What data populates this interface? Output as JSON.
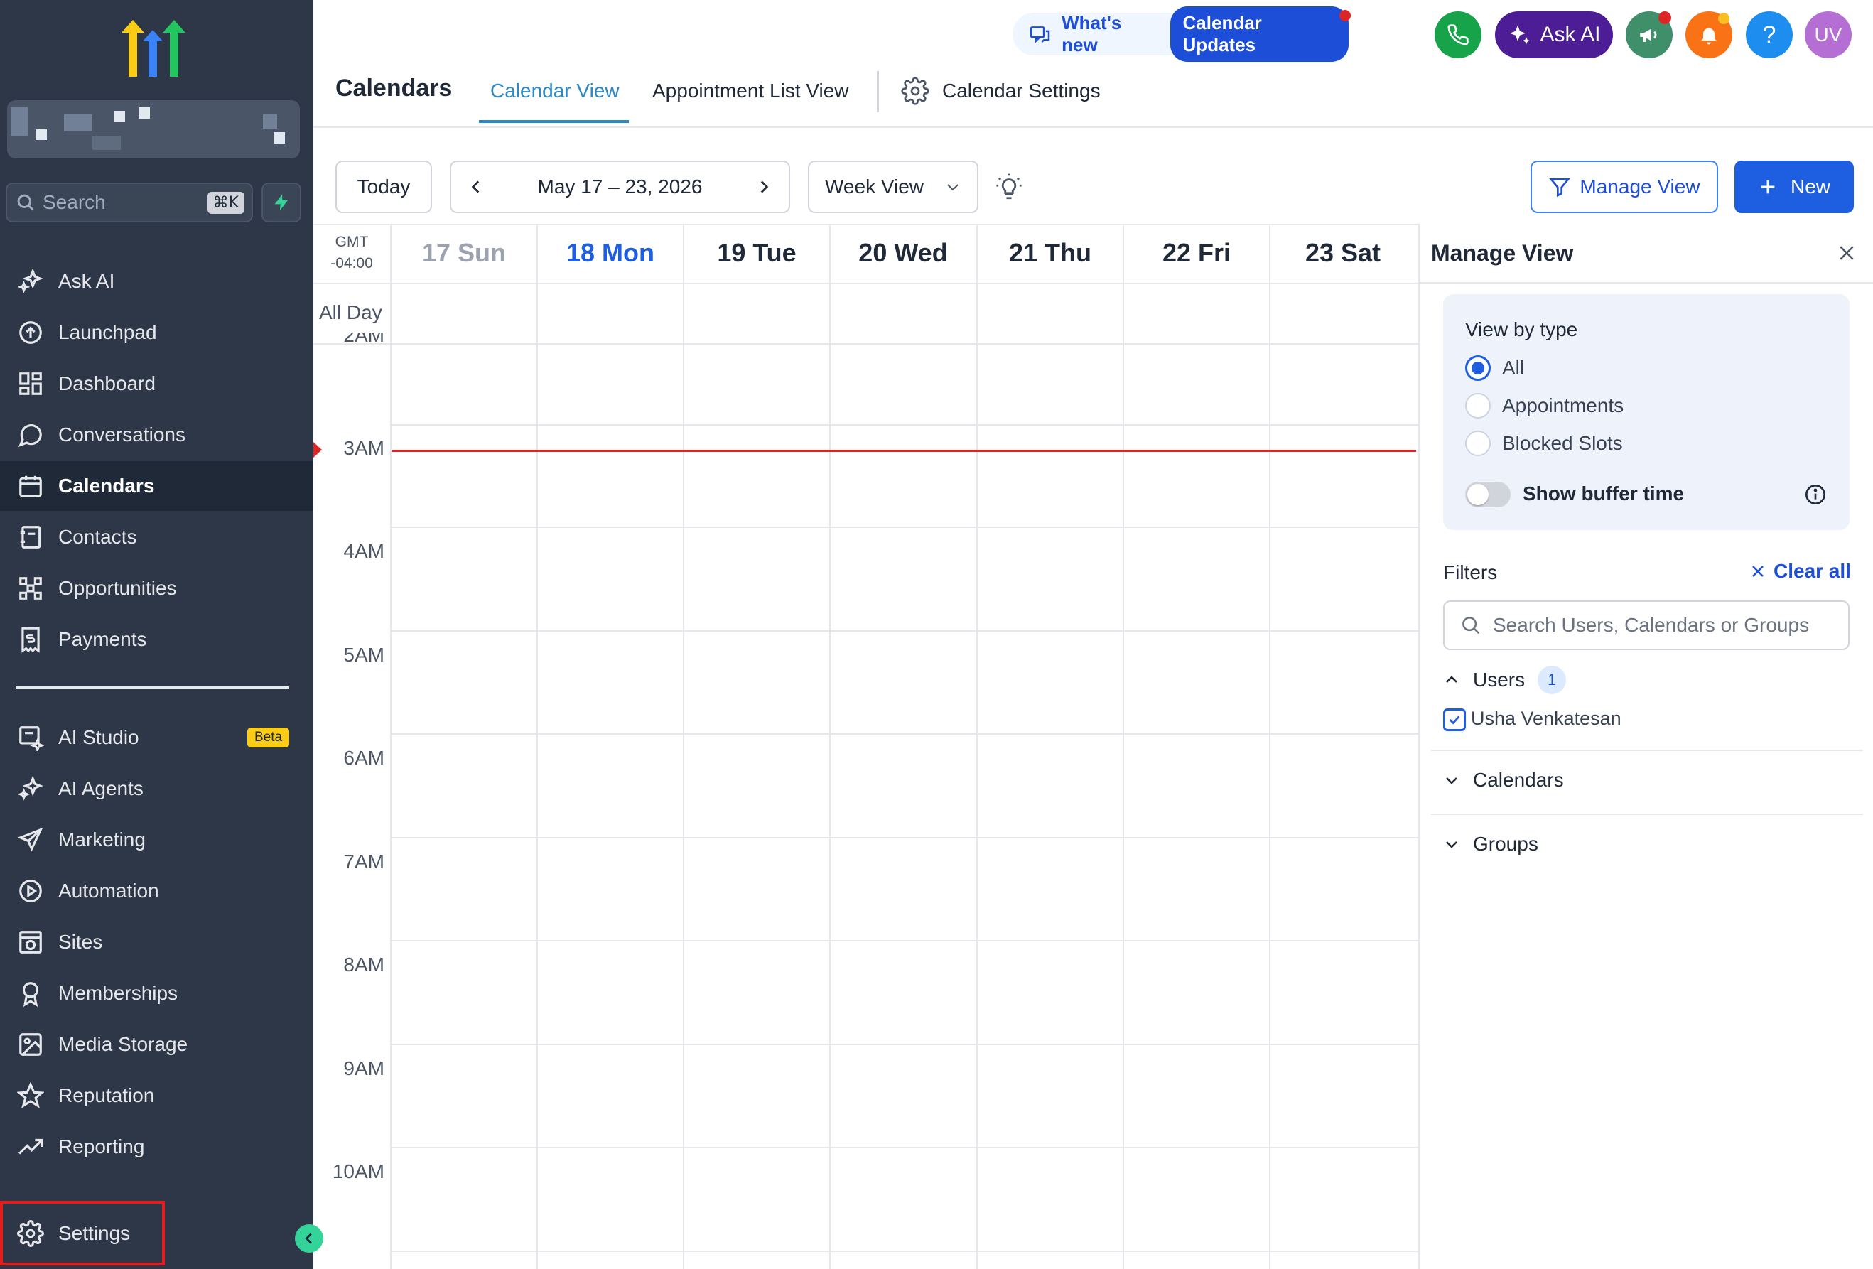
{
  "sidebar": {
    "search_placeholder": "Search",
    "search_shortcut": "⌘K",
    "items": [
      {
        "label": "Ask AI",
        "icon": "sparkle-icon"
      },
      {
        "label": "Launchpad",
        "icon": "launchpad-icon"
      },
      {
        "label": "Dashboard",
        "icon": "dashboard-icon"
      },
      {
        "label": "Conversations",
        "icon": "chat-bubble-icon"
      },
      {
        "label": "Calendars",
        "icon": "calendar-icon",
        "active": true
      },
      {
        "label": "Contacts",
        "icon": "contacts-icon"
      },
      {
        "label": "Opportunities",
        "icon": "opportunities-icon"
      },
      {
        "label": "Payments",
        "icon": "payments-icon"
      },
      {
        "label": "AI Studio",
        "icon": "ai-studio-icon",
        "badge": "Beta"
      },
      {
        "label": "AI Agents",
        "icon": "sparkle-icon"
      },
      {
        "label": "Marketing",
        "icon": "send-icon"
      },
      {
        "label": "Automation",
        "icon": "automation-icon"
      },
      {
        "label": "Sites",
        "icon": "globe-icon"
      },
      {
        "label": "Memberships",
        "icon": "award-icon"
      },
      {
        "label": "Media Storage",
        "icon": "image-icon"
      },
      {
        "label": "Reputation",
        "icon": "star-icon"
      },
      {
        "label": "Reporting",
        "icon": "trending-up-icon"
      }
    ],
    "settings_label": "Settings"
  },
  "topbar": {
    "whats_new": "What's new",
    "updates_pill": "Calendar Updates",
    "ask_ai": "Ask AI",
    "help": "?",
    "avatar_initials": "UV"
  },
  "header": {
    "title": "Calendars",
    "tabs": [
      {
        "label": "Calendar View",
        "active": true
      },
      {
        "label": "Appointment List View"
      },
      {
        "label": "Calendar Settings"
      }
    ]
  },
  "toolbar": {
    "today": "Today",
    "date_range": "May 17 – 23, 2026",
    "view_select": "Week View",
    "manage_view": "Manage View",
    "new": "New"
  },
  "calendar": {
    "timezone_line1": "GMT",
    "timezone_line2": "-04:00",
    "all_day": "All Day",
    "days": [
      "17 Sun",
      "18 Mon",
      "19 Tue",
      "20 Wed",
      "21 Thu",
      "22 Fri",
      "23 Sat"
    ],
    "partial_hour": "2AM",
    "hours": [
      "3AM",
      "4AM",
      "5AM",
      "6AM",
      "7AM",
      "8AM",
      "9AM",
      "10AM"
    ]
  },
  "manage_view": {
    "title": "Manage View",
    "view_by_type": "View by type",
    "types": [
      "All",
      "Appointments",
      "Blocked Slots"
    ],
    "selected_type": "All",
    "show_buffer": "Show buffer time",
    "show_buffer_on": false,
    "filters": "Filters",
    "clear_all": "Clear all",
    "search_placeholder": "Search Users, Calendars or Groups",
    "users_label": "Users",
    "users_count": "1",
    "user_name": "Usha Venkatesan",
    "calendars_label": "Calendars",
    "groups_label": "Groups"
  },
  "colors": {
    "sidebar_bg": "#2d3748",
    "accent": "#1d5fe0",
    "now_line": "#dc2626",
    "ask_ai_bg": "#4c1d95"
  }
}
